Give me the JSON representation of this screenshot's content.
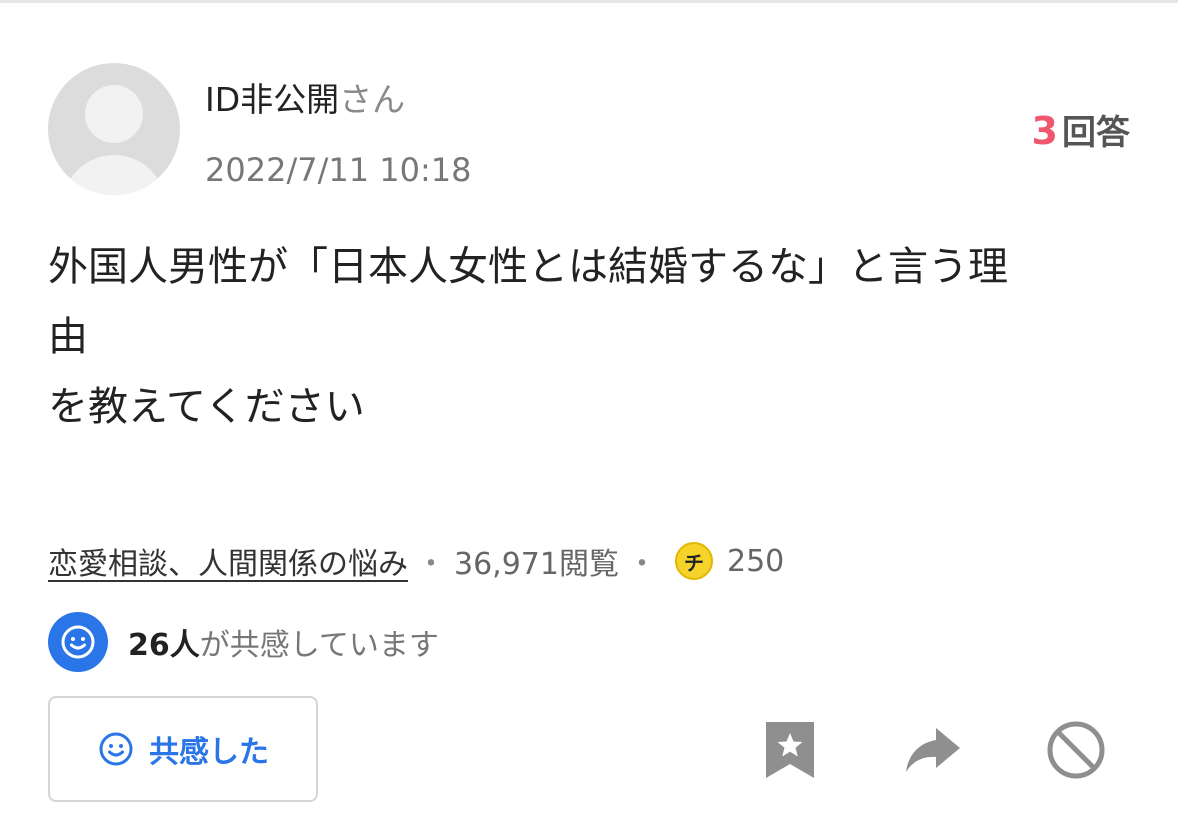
{
  "post": {
    "user_name": "ID非公開",
    "user_suffix": "さん",
    "timestamp": "2022/7/11 10:18",
    "answers_count": "3",
    "answers_label": "回答",
    "question_text": "外国人男性が「日本人女性とは結婚するな」と言う理\n由\nを教えてください"
  },
  "meta": {
    "category": "恋愛相談、人間関係の悩み",
    "separator": "・",
    "views": "36,971閲覧",
    "coin_label": "チ",
    "coin_amount": "250"
  },
  "empathy": {
    "count": "26人",
    "text": "が共感しています",
    "button_label": "共感した"
  },
  "icons": {
    "avatar": "default-user-avatar",
    "coin": "chiebukuro-coin-icon",
    "empathy": "smile-icon",
    "bookmark": "bookmark-star-icon",
    "share": "share-arrow-icon",
    "block": "block-icon"
  },
  "colors": {
    "accent_blue": "#2a76e8",
    "answer_count_pink": "#f0566d",
    "coin_yellow": "#f6d32a",
    "icon_gray": "#8f8f8f"
  }
}
